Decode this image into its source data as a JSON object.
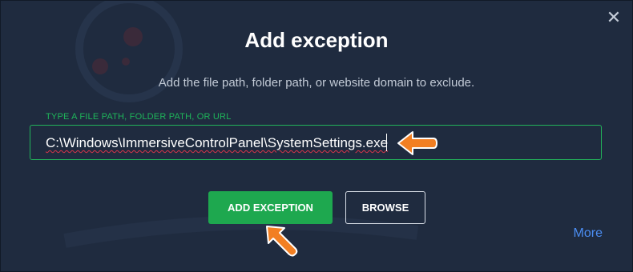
{
  "dialog": {
    "title": "Add exception",
    "subtitle": "Add the file path, folder path, or website domain to exclude.",
    "close_glyph": "✕",
    "field": {
      "label": "TYPE A FILE PATH, FOLDER PATH, OR URL",
      "value": "C:\\Windows\\ImmersiveControlPanel\\SystemSettings.exe"
    },
    "buttons": {
      "primary_label": "ADD EXCEPTION",
      "secondary_label": "BROWSE"
    },
    "more_label": "More"
  },
  "colors": {
    "background": "#1f2b3f",
    "accent_green": "#1ea84f",
    "link_blue": "#4b8df2",
    "annotation_orange": "#f27f22"
  },
  "icons": [
    "close-icon",
    "arrow-pointer-icon"
  ]
}
